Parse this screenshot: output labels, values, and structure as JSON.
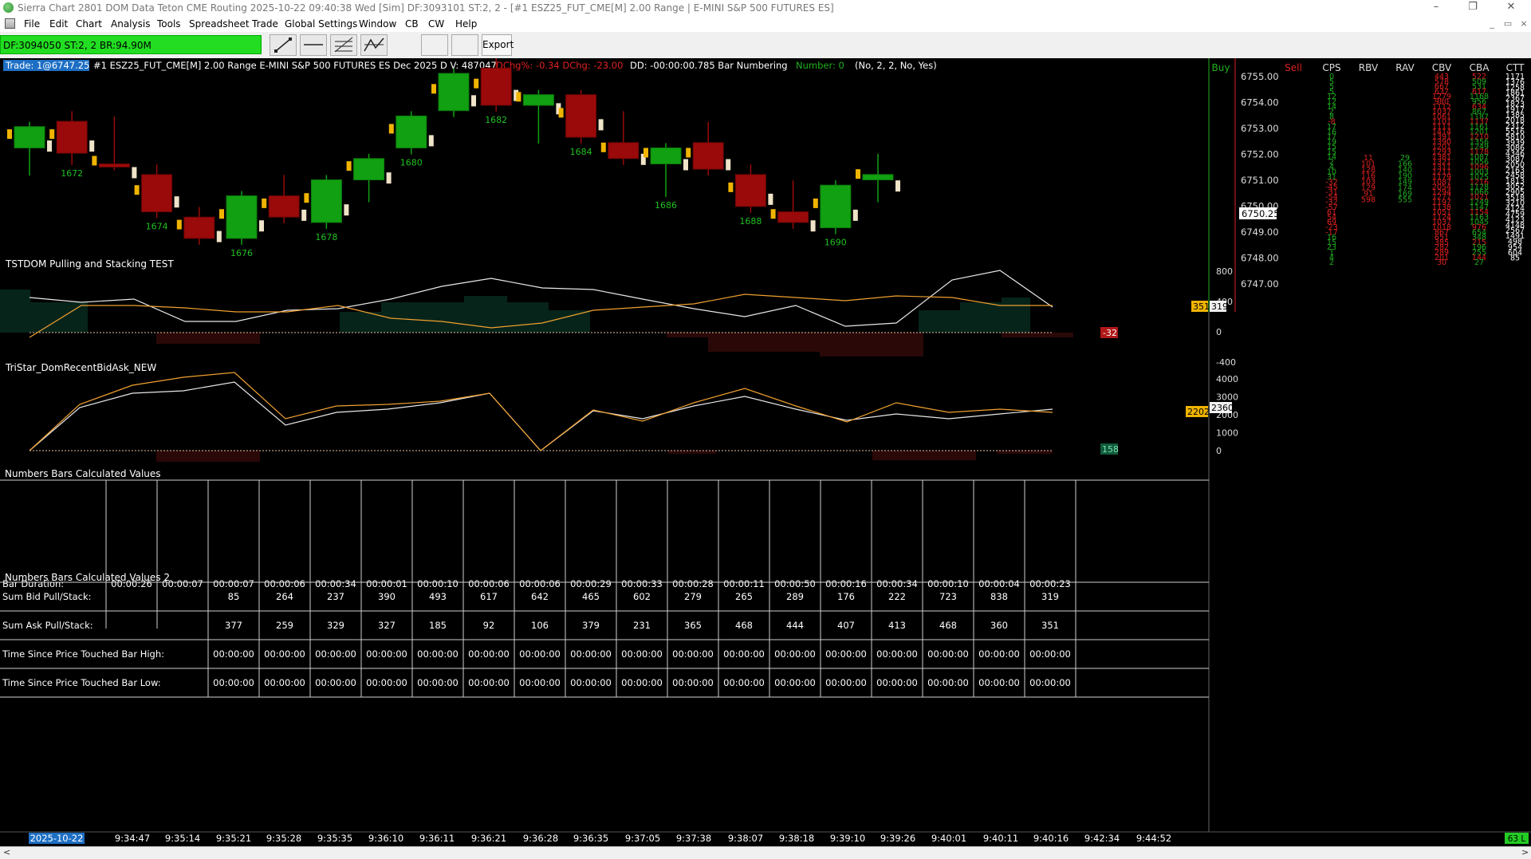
{
  "window": {
    "title": "Sierra Chart 2801 DOM Data Teton CME Routing 2025-10-22  09:40:38 Wed [Sim] DF:3093101  ST:2, 2 - [#1 ESZ25_FUT_CME[M]  2.00 Range | E-MINI S&P 500 FUTURES ES]",
    "minimize_glyph": "–",
    "maximize_glyph": "❐",
    "close_glyph": "✕",
    "mdi_min_glyph": "_",
    "mdi_restore_glyph": "▭",
    "mdi_close_glyph": "×"
  },
  "menu": [
    "File",
    "Edit",
    "Chart",
    "Analysis",
    "Tools",
    "Spreadsheet",
    "Trade",
    "Global Settings",
    "Window",
    "CB",
    "CW",
    "Help"
  ],
  "toolbar": {
    "df_status": "DF:3094050  ST:2, 2  BR:94.90M",
    "tools": [
      "line-tool-icon",
      "horizontal-line-tool-icon",
      "fib-tool-icon",
      "rays-tool-icon"
    ],
    "export_label": "Export"
  },
  "chart_header": {
    "trade": "Trade: 1@6747.25",
    "symbol": "#1 ESZ25_FUT_CME[M]  2.00 Range E-MINI S&P 500 FUTURES ES Dec 2025 D V: 487047",
    "dchg": "DChg%: -0.34 DChg: -23.00",
    "dd": "DD: -00:00:00.785 Bar Numbering",
    "number": "Number: 0",
    "params": "(No, 2, 2, No, Yes)"
  },
  "colors": {
    "up": "#11a011",
    "down": "#9a0a0a",
    "accent": "#f0b400",
    "sub_white": "#e8e8e8",
    "sub_orange": "#f0a030",
    "green_text": "#20b020",
    "red_text": "#e02020",
    "status_green": "#22cc22"
  },
  "price_chart": {
    "price_axis": [
      "6755.00",
      "6754.00",
      "6753.00",
      "6752.00",
      "6751.00",
      "6750.00",
      "6749.00",
      "6748.00",
      "6747.00"
    ],
    "last_price": "6750.25",
    "bar_numbers": [
      "1672",
      "1674",
      "1676",
      "1678",
      "1680",
      "1682",
      "1684",
      "1686",
      "1688",
      "1690"
    ],
    "candles": [
      {
        "o": 6751.5,
        "c": 6752.5,
        "h": 6752.5,
        "l": 6750.5,
        "dir": "up"
      },
      {
        "o": 6752.75,
        "c": 6751.25,
        "h": 6753.0,
        "l": 6751.0,
        "dir": "down"
      },
      {
        "o": 6750.75,
        "c": 6750.75,
        "h": 6752.75,
        "l": 6750.75,
        "dir": "down"
      },
      {
        "o": 6750.25,
        "c": 6748.5,
        "h": 6750.5,
        "l": 6748.5,
        "dir": "down"
      },
      {
        "o": 6748.25,
        "c": 6747.25,
        "h": 6748.5,
        "l": 6747.25,
        "dir": "down"
      },
      {
        "o": 6747.25,
        "c": 6749.25,
        "h": 6749.25,
        "l": 6747.25,
        "dir": "up"
      },
      {
        "o": 6748.25,
        "c": 6749.25,
        "h": 6750.0,
        "l": 6748.25,
        "dir": "down"
      },
      {
        "o": 6748.0,
        "c": 6750.0,
        "h": 6750.0,
        "l": 6748.0,
        "dir": "up"
      },
      {
        "o": 6750.0,
        "c": 6751.0,
        "h": 6751.0,
        "l": 6749.25,
        "dir": "up"
      },
      {
        "o": 6751.5,
        "c": 6753.0,
        "h": 6753.0,
        "l": 6751.5,
        "dir": "up"
      },
      {
        "o": 6753.25,
        "c": 6755.0,
        "h": 6755.0,
        "l": 6753.25,
        "dir": "up"
      },
      {
        "o": 6755.25,
        "c": 6753.5,
        "h": 6755.5,
        "l": 6753.5,
        "dir": "down"
      },
      {
        "o": 6753.5,
        "c": 6754.0,
        "h": 6754.0,
        "l": 6752.0,
        "dir": "up"
      },
      {
        "o": 6754.0,
        "c": 6752.0,
        "h": 6754.0,
        "l": 6752.0,
        "dir": "down"
      },
      {
        "o": 6751.75,
        "c": 6751.0,
        "h": 6753.0,
        "l": 6751.0,
        "dir": "down"
      },
      {
        "o": 6750.75,
        "c": 6751.5,
        "h": 6751.5,
        "l": 6749.5,
        "dir": "up"
      },
      {
        "o": 6751.75,
        "c": 6750.5,
        "h": 6752.5,
        "l": 6750.5,
        "dir": "down"
      },
      {
        "o": 6750.25,
        "c": 6748.75,
        "h": 6750.5,
        "l": 6748.75,
        "dir": "down"
      },
      {
        "o": 6748.5,
        "c": 6748.0,
        "h": 6749.75,
        "l": 6748.0,
        "dir": "down"
      },
      {
        "o": 6747.75,
        "c": 6749.75,
        "h": 6749.75,
        "l": 6747.75,
        "dir": "up"
      },
      {
        "o": 6750.25,
        "c": 6750.0,
        "h": 6751.0,
        "l": 6749.25,
        "dir": "up"
      }
    ]
  },
  "dom_columns": {
    "headers": [
      "Buy",
      "Sell",
      "CPS",
      "RBV",
      "RAV",
      "CBV",
      "CBA",
      "CTT"
    ],
    "cps": [
      "0",
      "5",
      "5",
      "5",
      "12",
      "12",
      "14",
      "2",
      "8",
      "-8",
      "17",
      "16",
      "17",
      "19",
      "15",
      "15",
      "14",
      "2",
      "4",
      "10",
      "31",
      "-32",
      "-45",
      "-31",
      "-54",
      "-32",
      "-57",
      "61",
      "54",
      "69",
      "-23",
      "-17",
      "16",
      "15",
      "23",
      "1",
      "4",
      "2"
    ],
    "rbv": [
      "11",
      "101",
      "128",
      "116",
      "103",
      "129",
      "91",
      "598"
    ],
    "rav": [
      "29",
      "166",
      "140",
      "190",
      "149",
      "174",
      "169",
      "555"
    ],
    "cbv": [
      "443",
      "578",
      "667",
      "637",
      "1279",
      "980",
      "1112",
      "1037",
      "1061",
      "1101",
      "1111",
      "1414",
      "1391",
      "1390",
      "1201",
      "1293",
      "1381",
      "1321",
      "1311",
      "1211",
      "1179",
      "1087",
      "2054",
      "1294",
      "1277",
      "1197",
      "1138",
      "1051",
      "1124",
      "1037",
      "1018",
      "867",
      "651",
      "385",
      "282",
      "289",
      "201",
      "30"
    ],
    "cba": [
      "522",
      "509",
      "531",
      "617",
      "1168",
      "956",
      "634",
      "867",
      "1187",
      "1137",
      "1161",
      "1201",
      "1210",
      "1356",
      "1249",
      "1178",
      "1087",
      "1056",
      "1096",
      "1003",
      "1025",
      "1216",
      "1128",
      "1066",
      "1021",
      "1249",
      "1147",
      "1154",
      "1163",
      "1045",
      "976",
      "654",
      "348",
      "215",
      "196",
      "255",
      "144",
      "27"
    ],
    "ctt": [
      "1171",
      "1376",
      "1258",
      "1861",
      "2367",
      "1823",
      "1917",
      "1385",
      "2018",
      "2312",
      "5516",
      "5810",
      "3939",
      "3086",
      "4346",
      "3087",
      "2050",
      "2163",
      "2458",
      "1813",
      "3052",
      "2905",
      "3518",
      "3210",
      "4124",
      "4759",
      "4123",
      "4148",
      "2567",
      "1491",
      "498",
      "954",
      "604",
      "85"
    ]
  },
  "study1": {
    "title": "TSTDOM Pulling and Stacking TEST",
    "axis": [
      "800",
      "400",
      "0",
      "-400"
    ],
    "orange_value": "351",
    "white_value": "319",
    "red_value": "-32"
  },
  "study2": {
    "title": "TriStar_DomRecentBidAsk_NEW",
    "axis": [
      "4000",
      "3000",
      "2000",
      "1000",
      "0"
    ],
    "orange_value": "2202",
    "white_value": "2360",
    "green_value": "158"
  },
  "table1": {
    "title": "Numbers Bars Calculated Values",
    "row_label": "Bar Duration:",
    "values": [
      "00:00:26",
      "00:00:07",
      "00:00:07",
      "00:00:06",
      "00:00:34",
      "00:00:01",
      "00:00:10",
      "00:00:06",
      "00:00:06",
      "00:00:29",
      "00:00:33",
      "00:00:28",
      "00:00:11",
      "00:00:50",
      "00:00:16",
      "00:00:34",
      "00:00:10",
      "00:00:04",
      "00:00:23"
    ]
  },
  "table2": {
    "title": "Numbers Bars Calculated Values 2",
    "rows": [
      {
        "label": "Sum Bid Pull/Stack:",
        "values": [
          "85",
          "264",
          "237",
          "390",
          "493",
          "617",
          "642",
          "465",
          "602",
          "279",
          "265",
          "289",
          "176",
          "222",
          "723",
          "838",
          "319"
        ]
      },
      {
        "label": "Sum Ask Pull/Stack:",
        "values": [
          "377",
          "259",
          "329",
          "327",
          "185",
          "92",
          "106",
          "379",
          "231",
          "365",
          "468",
          "444",
          "407",
          "413",
          "468",
          "360",
          "351"
        ]
      },
      {
        "label": "Time Since Price Touched Bar High:",
        "values": [
          "00:00:00",
          "00:00:00",
          "00:00:00",
          "00:00:00",
          "00:00:00",
          "00:00:00",
          "00:00:00",
          "00:00:00",
          "00:00:00",
          "00:00:00",
          "00:00:00",
          "00:00:00",
          "00:00:00",
          "00:00:00",
          "00:00:00",
          "00:00:00",
          "00:00:00"
        ]
      },
      {
        "label": "Time Since Price Touched Bar Low:",
        "values": [
          "00:00:00",
          "00:00:00",
          "00:00:00",
          "00:00:00",
          "00:00:00",
          "00:00:00",
          "00:00:00",
          "00:00:00",
          "00:00:00",
          "00:00:00",
          "00:00:00",
          "00:00:00",
          "00:00:00",
          "00:00:00",
          "00:00:00",
          "00:00:00",
          "00:00:00"
        ]
      }
    ]
  },
  "time_axis": [
    "2025-10-22",
    "9:34:47",
    "9:35:14",
    "9:35:21",
    "9:35:28",
    "9:35:35",
    "9:36:10",
    "9:36:11",
    "9:36:21",
    "9:36:28",
    "9:36:35",
    "9:37:05",
    "9:37:38",
    "9:38:07",
    "9:38:18",
    "9:39:10",
    "9:39:26",
    "9:40:01",
    "9:40:11",
    "9:40:16",
    "9:42:34",
    "9:44:52"
  ],
  "status": {
    "right_badge": "63 L",
    "scroll_left": "<",
    "scroll_right": ">"
  }
}
